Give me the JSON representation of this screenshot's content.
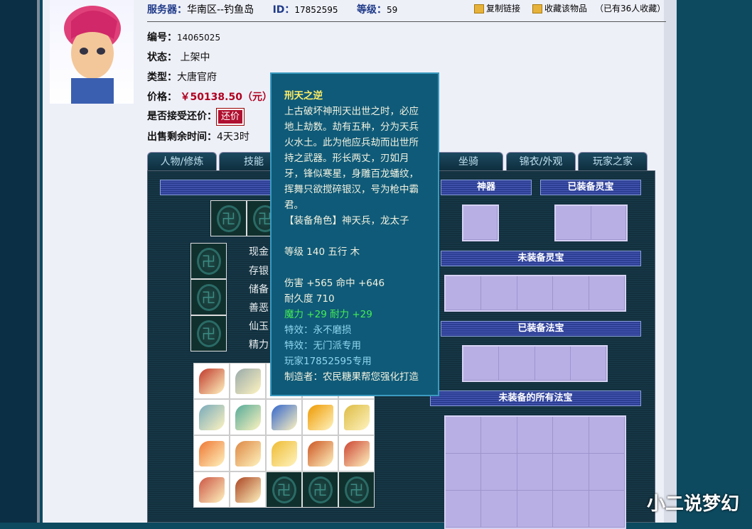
{
  "header": {
    "server_label": "服务器：",
    "server": "华南区--钓鱼岛",
    "id_label": "ID：",
    "id": "17852595",
    "level_label": "等级：",
    "level": "59",
    "copy_link": "复制链接",
    "favorite": "收藏该物品",
    "fav_count": "（已有36人收藏）"
  },
  "info": {
    "num_label": "编号：",
    "num": "14065025",
    "status_label": "状态：",
    "status": "上架中",
    "type_label": "类型：",
    "type": "大唐官府",
    "price_label": "价格：",
    "price": "￥50138.50（元）",
    "bargain_label": "是否接受还价：",
    "bargain_button": "还价",
    "time_label": "出售剩余时间：",
    "time": "4天3时"
  },
  "tabs": [
    "人物/修炼",
    "技能",
    "",
    "",
    "坐骑",
    "锦衣/外观",
    "玩家之家"
  ],
  "stats": [
    "现金",
    "存银",
    "储备",
    "善恶",
    "仙玉",
    "精力"
  ],
  "right": {
    "shenqi": "神器",
    "equipped_lingbao": "已装备灵宝",
    "unequipped_lingbao": "未装备灵宝",
    "equipped_fabao": "已装备法宝",
    "all_fabao": "未装备的所有法宝"
  },
  "tooltip": {
    "title": "刑天之逆",
    "desc": "上古破坏神刑天出世之时，必应地上劫数。劫有五种，分为天兵火水土。此为他应兵劫而出世所持之武器。形长两丈，刃如月牙，锋似寒星，身雕百龙蟠纹，挥舞只欲搅碎银汉，号为枪中霸君。",
    "role": "【装备角色】神天兵，龙太子",
    "level": "等级 140 五行 木",
    "attack": "伤害 +565 命中 +646",
    "durability": "耐久度 710",
    "bonus": "魔力 +29 耐力 +29",
    "effect1": "特效：永不磨损",
    "effect2": "特效：无门派专用",
    "owner": "玩家17852595专用",
    "maker": "制造者：农民糖果帮您强化打造"
  },
  "watermark": "小二说梦幻",
  "item_colors": [
    "#c0392b",
    "#9aa",
    "#fff",
    "#fff",
    "#fff",
    "#7ab",
    "#5a9",
    "#36c",
    "#e90",
    "#db4",
    "#e73",
    "#d84",
    "#eb3",
    "#c52",
    "#c43",
    "#c54",
    "#a42",
    "",
    "",
    ""
  ]
}
